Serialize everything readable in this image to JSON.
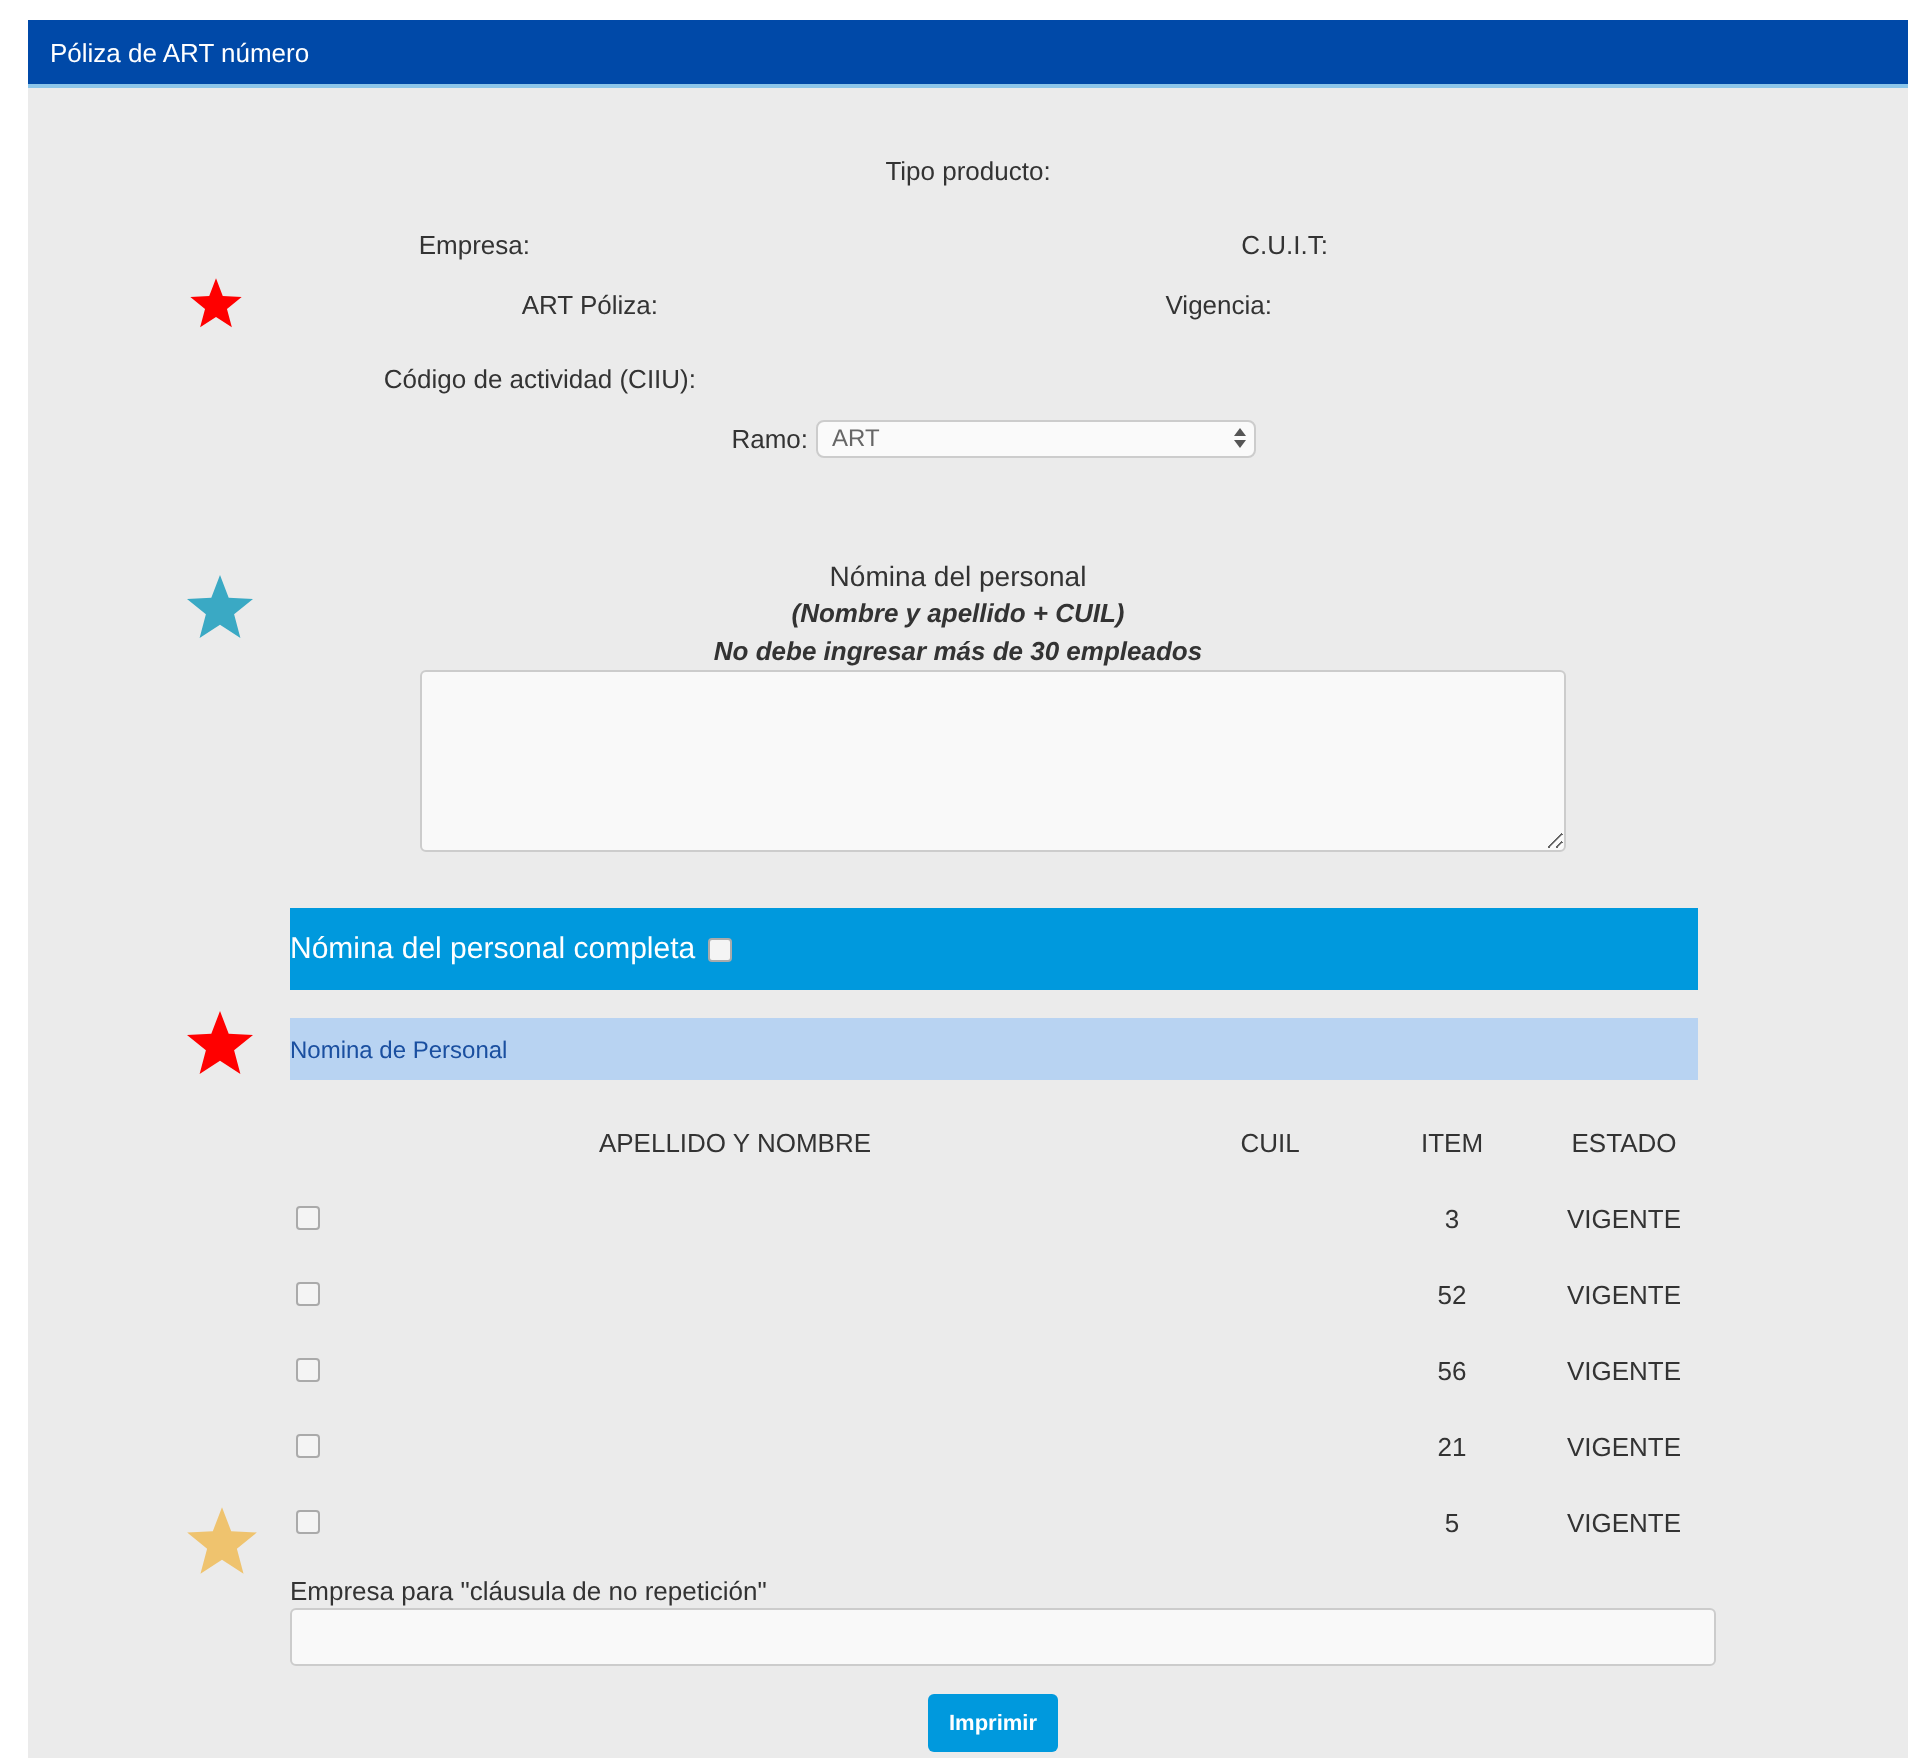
{
  "header": {
    "title": "Póliza de ART número"
  },
  "info": {
    "product_type": "Tipo producto:",
    "company": "Empresa:",
    "cuit": "C.U.I.T:",
    "policy": "ART Póliza:",
    "validity": "Vigencia:",
    "activity_code": "Código de actividad (CIIU):"
  },
  "ramo": {
    "label": "Ramo:",
    "value": "ART"
  },
  "staff_list": {
    "title": "Nómina del personal",
    "hint_1": "(Nombre y apellido + CUIL)",
    "hint_2": "No debe ingresar más de 30 empleados"
  },
  "complete_bar": {
    "label": "Nómina del personal completa",
    "checked": false
  },
  "section_bar": {
    "title": "Nomina de Personal"
  },
  "table": {
    "columns": [
      "APELLIDO Y NOMBRE",
      "CUIL",
      "ITEM",
      "ESTADO"
    ],
    "rows": [
      {
        "checked": false,
        "item": "3",
        "status": "VIGENTE"
      },
      {
        "checked": false,
        "item": "52",
        "status": "VIGENTE"
      },
      {
        "checked": false,
        "item": "56",
        "status": "VIGENTE"
      },
      {
        "checked": false,
        "item": "21",
        "status": "VIGENTE"
      },
      {
        "checked": false,
        "item": "5",
        "status": "VIGENTE"
      }
    ]
  },
  "no_repetition": {
    "label": "Empresa para \"cláusula de no repetición\""
  },
  "buttons": [
    "Imprimir"
  ],
  "annotation_stars": [
    {
      "color": "#ff0000"
    },
    {
      "color": "#3aa9c4"
    },
    {
      "color": "#ff0000"
    },
    {
      "color": "#efc36e"
    }
  ]
}
